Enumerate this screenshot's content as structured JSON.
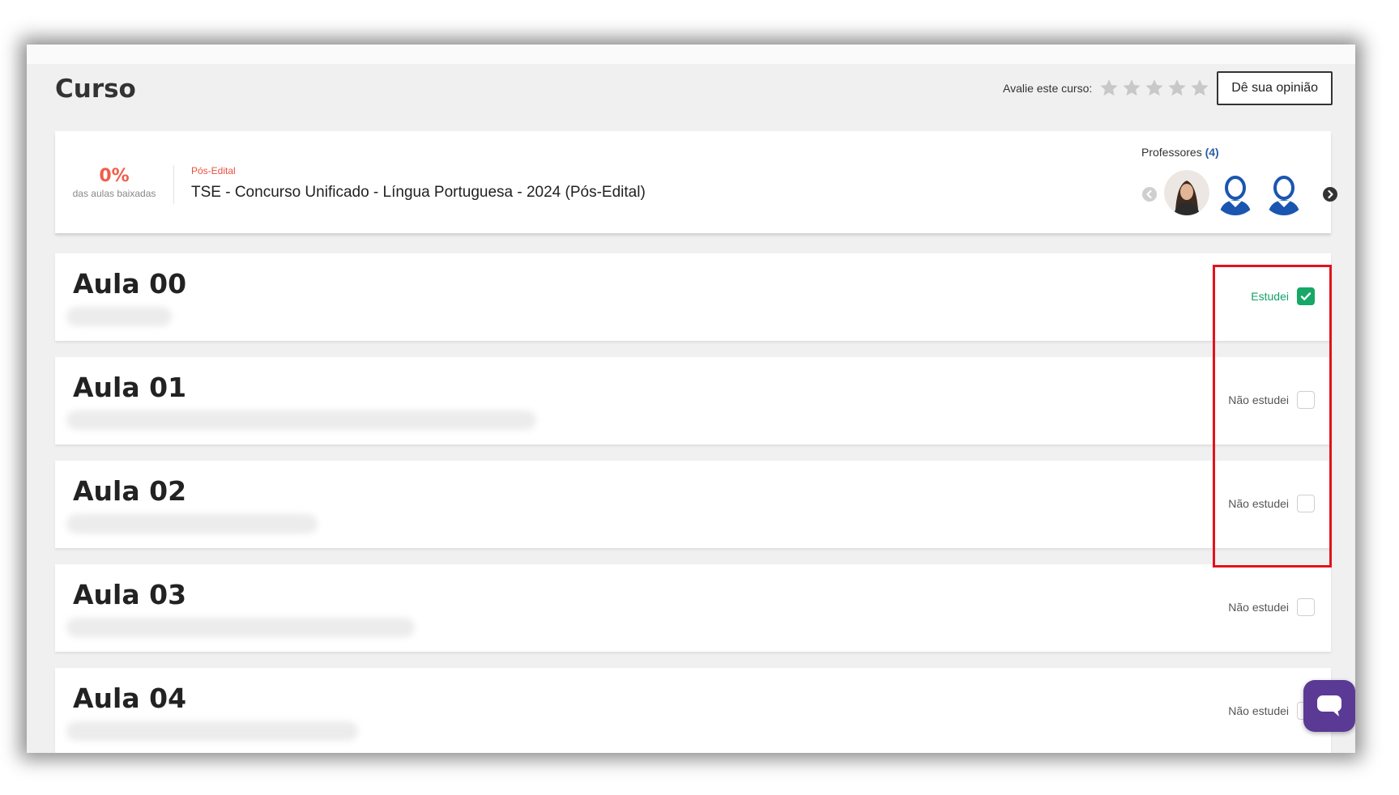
{
  "header": {
    "title": "Curso",
    "rating_label": "Avalie este curso:",
    "stars": 5,
    "star_color": "#c8c8c8",
    "opinion_button": "Dê sua opinião"
  },
  "course": {
    "progress_percent": "0%",
    "progress_caption": "das aulas baixadas",
    "tag": "Pós-Edital",
    "name": "TSE - Concurso Unificado - Língua Portuguesa - 2024 (Pós-Edital)",
    "professors_label": "Professores",
    "professors_count": "(4)"
  },
  "lessons": [
    {
      "title": "Aula 00",
      "status": "Estudei",
      "checked": true
    },
    {
      "title": "Aula 01",
      "status": "Não estudei",
      "checked": false
    },
    {
      "title": "Aula 02",
      "status": "Não estudei",
      "checked": false
    },
    {
      "title": "Aula 03",
      "status": "Não estudei",
      "checked": false
    },
    {
      "title": "Aula 04",
      "status": "Não estudei",
      "checked": false
    }
  ],
  "colors": {
    "accent_red": "#e8513d",
    "done_green": "#16a866",
    "chat_purple": "#5b3a96",
    "highlight": "#e3121b",
    "avatar_blue": "#1a56b0"
  }
}
